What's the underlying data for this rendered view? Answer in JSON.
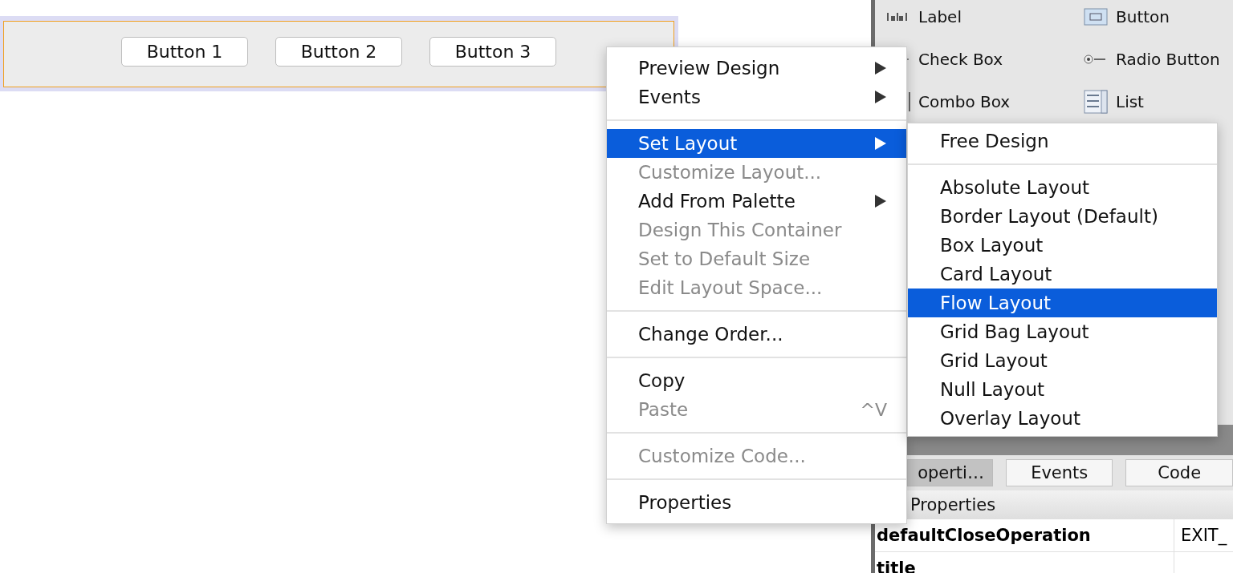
{
  "designer": {
    "buttons": [
      "Button 1",
      "Button 2",
      "Button 3"
    ]
  },
  "palette": {
    "items": [
      {
        "label": "Label",
        "kind": "label"
      },
      {
        "label": "Button",
        "kind": "button"
      },
      {
        "label": "Check Box",
        "kind": "checkbox"
      },
      {
        "label": "Radio Button",
        "kind": "radio"
      },
      {
        "label": "Combo Box",
        "kind": "combo"
      },
      {
        "label": "List",
        "kind": "list"
      }
    ]
  },
  "properties": {
    "tabs": [
      {
        "label": "operti…",
        "selected": true
      },
      {
        "label": "Events",
        "selected": false
      },
      {
        "label": "Code",
        "selected": false
      }
    ],
    "section": "Properties",
    "rows": [
      {
        "name": "defaultCloseOperation",
        "value": "EXIT_"
      },
      {
        "name": "title",
        "value": ""
      }
    ]
  },
  "context_menu": {
    "items": [
      {
        "kind": "item",
        "label": "Preview Design",
        "disabled": false,
        "submenu": true,
        "selected": false
      },
      {
        "kind": "item",
        "label": "Events",
        "disabled": false,
        "submenu": true,
        "selected": false
      },
      {
        "kind": "separator"
      },
      {
        "kind": "item",
        "label": "Set Layout",
        "disabled": false,
        "submenu": true,
        "selected": true
      },
      {
        "kind": "item",
        "label": "Customize Layout...",
        "disabled": true,
        "submenu": false,
        "selected": false
      },
      {
        "kind": "item",
        "label": "Add From Palette",
        "disabled": false,
        "submenu": true,
        "selected": false
      },
      {
        "kind": "item",
        "label": "Design This Container",
        "disabled": true,
        "submenu": false,
        "selected": false
      },
      {
        "kind": "item",
        "label": "Set to Default Size",
        "disabled": true,
        "submenu": false,
        "selected": false
      },
      {
        "kind": "item",
        "label": "Edit Layout Space...",
        "disabled": true,
        "submenu": false,
        "selected": false
      },
      {
        "kind": "separator"
      },
      {
        "kind": "item",
        "label": "Change Order...",
        "disabled": false,
        "submenu": false,
        "selected": false
      },
      {
        "kind": "separator"
      },
      {
        "kind": "item",
        "label": "Copy",
        "disabled": false,
        "submenu": false,
        "selected": false
      },
      {
        "kind": "item",
        "label": "Paste",
        "disabled": true,
        "submenu": false,
        "selected": false,
        "shortcut": "^V"
      },
      {
        "kind": "separator"
      },
      {
        "kind": "item",
        "label": "Customize Code...",
        "disabled": true,
        "submenu": false,
        "selected": false
      },
      {
        "kind": "separator"
      },
      {
        "kind": "item",
        "label": "Properties",
        "disabled": false,
        "submenu": false,
        "selected": false
      }
    ]
  },
  "submenu": {
    "items": [
      {
        "kind": "item",
        "label": "Free Design",
        "selected": false
      },
      {
        "kind": "separator"
      },
      {
        "kind": "item",
        "label": "Absolute Layout",
        "selected": false
      },
      {
        "kind": "item",
        "label": "Border Layout (Default)",
        "selected": false
      },
      {
        "kind": "item",
        "label": "Box Layout",
        "selected": false
      },
      {
        "kind": "item",
        "label": "Card Layout",
        "selected": false
      },
      {
        "kind": "item",
        "label": "Flow Layout",
        "selected": true
      },
      {
        "kind": "item",
        "label": "Grid Bag Layout",
        "selected": false
      },
      {
        "kind": "item",
        "label": "Grid Layout",
        "selected": false
      },
      {
        "kind": "item",
        "label": "Null Layout",
        "selected": false
      },
      {
        "kind": "item",
        "label": "Overlay Layout",
        "selected": false
      }
    ]
  }
}
